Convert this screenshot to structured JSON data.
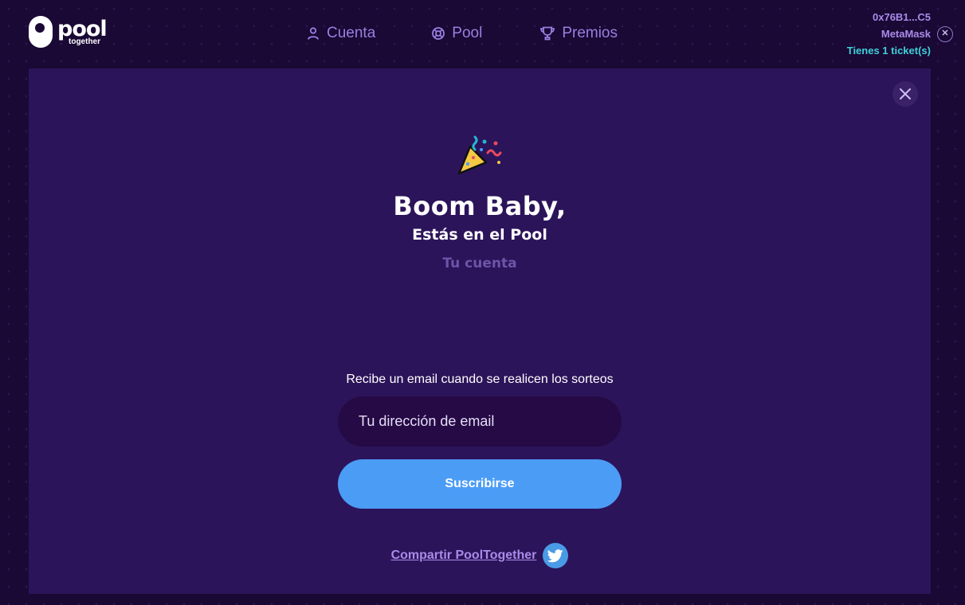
{
  "header": {
    "logo": {
      "word": "pool",
      "sub": "together"
    },
    "nav": [
      {
        "label": "Cuenta",
        "icon": "user-icon"
      },
      {
        "label": "Pool",
        "icon": "lifebuoy-icon"
      },
      {
        "label": "Premios",
        "icon": "trophy-icon"
      }
    ],
    "wallet": {
      "address": "0x76B1...C5",
      "provider": "MetaMask",
      "tickets": "Tienes 1 ticket(s)"
    }
  },
  "modal": {
    "emoji": "party-popper-icon",
    "title": "Boom Baby,",
    "subtitle": "Estás en el Pool",
    "account_link": "Tu cuenta",
    "email_label": "Recibe un email cuando se realicen los sorteos",
    "email_placeholder": "Tu dirección de email",
    "subscribe_label": "Suscribirse",
    "share_label": "Compartir PoolTogether"
  },
  "colors": {
    "background": "#1a0835",
    "panel": "#2c145a",
    "accent": "#9b7fe0",
    "button": "#4b9cf5",
    "tickets": "#3fd1d7"
  }
}
